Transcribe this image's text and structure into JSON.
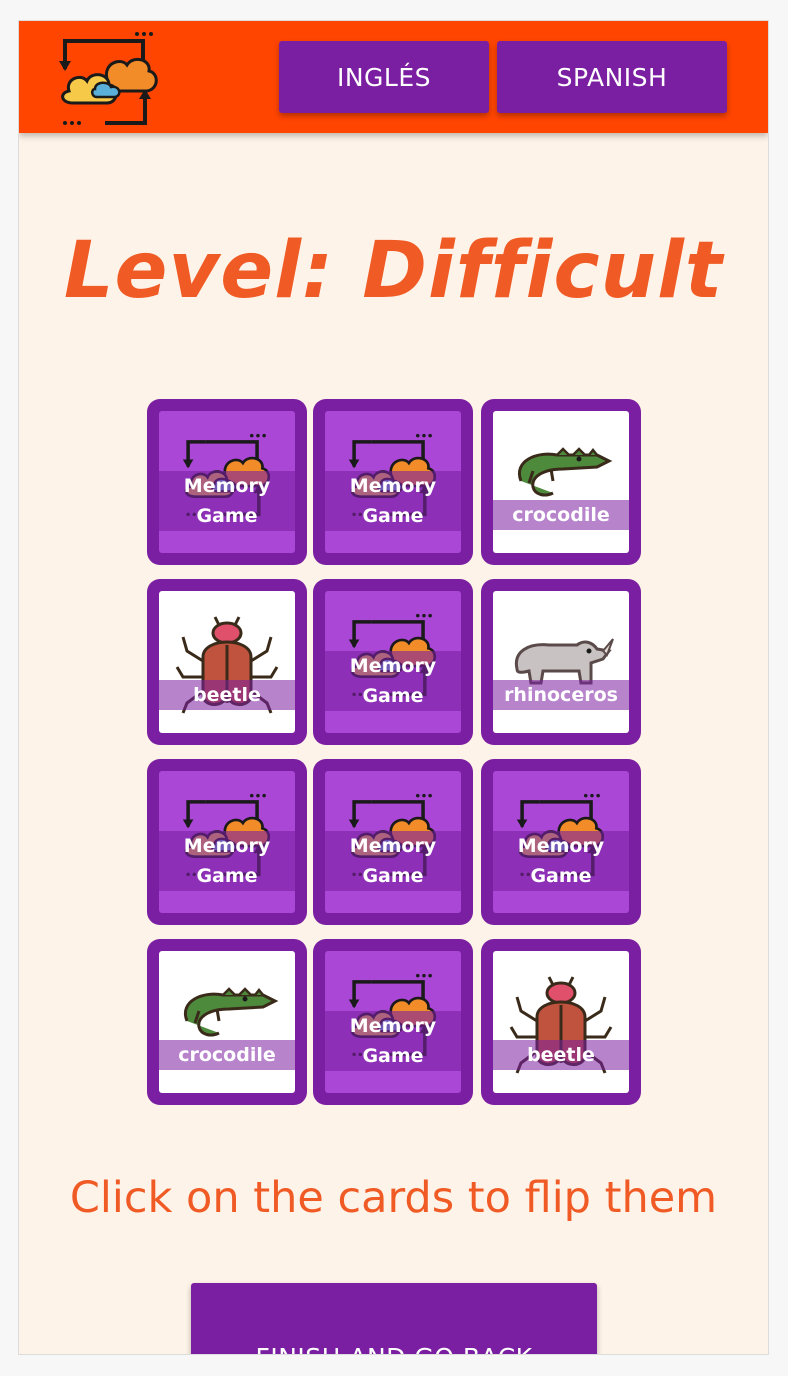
{
  "header": {
    "logo_icon": "memory-game-logo-icon",
    "background": "#ff4500",
    "lang_buttons": [
      "INGLÉS",
      "SPANISH"
    ]
  },
  "title": "Level: Difficult",
  "cards": [
    {
      "state": "back",
      "label": "Memory\nGame",
      "icon": "memory-game-logo-icon"
    },
    {
      "state": "back",
      "label": "Memory\nGame",
      "icon": "memory-game-logo-icon"
    },
    {
      "state": "front",
      "label": "crocodile",
      "icon": "crocodile-icon"
    },
    {
      "state": "front",
      "label": "beetle",
      "icon": "beetle-icon"
    },
    {
      "state": "back",
      "label": "Memory\nGame",
      "icon": "memory-game-logo-icon"
    },
    {
      "state": "front",
      "label": "rhinoceros",
      "icon": "rhinoceros-icon"
    },
    {
      "state": "back",
      "label": "Memory\nGame",
      "icon": "memory-game-logo-icon"
    },
    {
      "state": "back",
      "label": "Memory\nGame",
      "icon": "memory-game-logo-icon"
    },
    {
      "state": "back",
      "label": "Memory\nGame",
      "icon": "memory-game-logo-icon"
    },
    {
      "state": "front",
      "label": "crocodile",
      "icon": "crocodile-icon"
    },
    {
      "state": "back",
      "label": "Memory\nGame",
      "icon": "memory-game-logo-icon"
    },
    {
      "state": "front",
      "label": "beetle",
      "icon": "beetle-icon"
    }
  ],
  "instruction": "Click on the cards to flip them",
  "finish_button": "FINISH AND GO BACK",
  "colors": {
    "accent": "#f05a24",
    "purple": "#7b1fa2",
    "card_back": "#ab47d6",
    "background": "#fef3e8"
  }
}
